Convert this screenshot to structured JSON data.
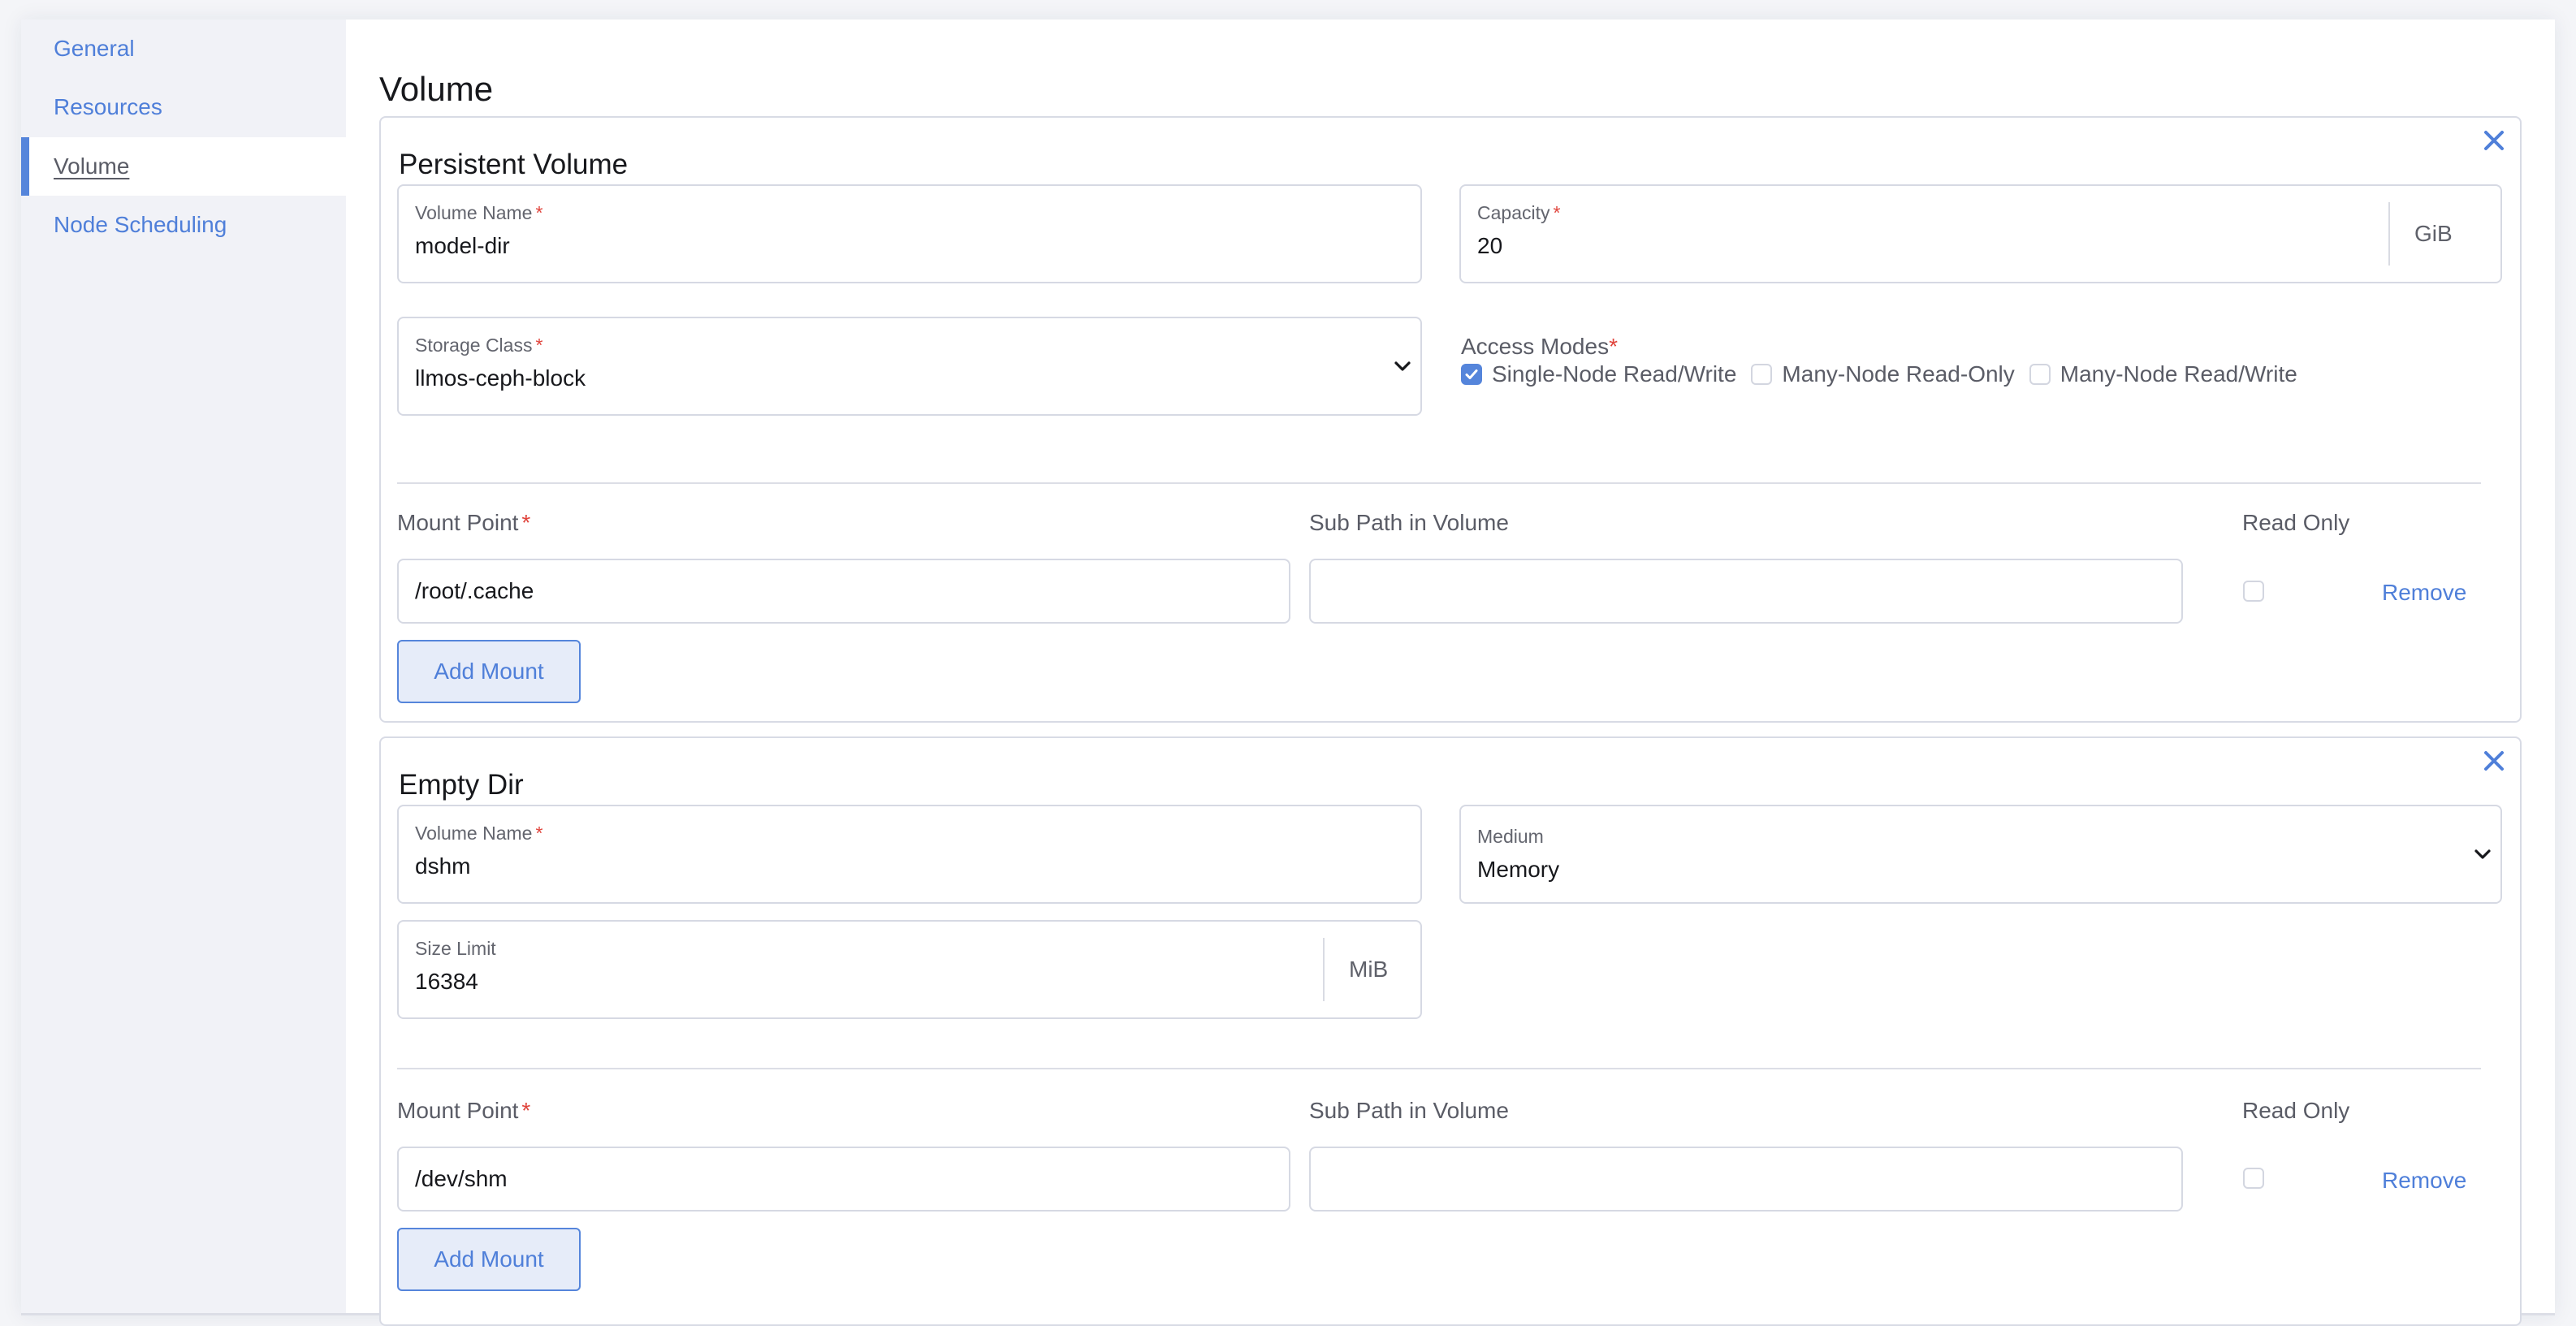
{
  "sidebar": {
    "items": [
      {
        "label": "General",
        "active": false
      },
      {
        "label": "Resources",
        "active": false
      },
      {
        "label": "Volume",
        "active": true
      },
      {
        "label": "Node Scheduling",
        "active": false
      }
    ]
  },
  "page": {
    "title": "Volume"
  },
  "colors": {
    "accent": "#5585db",
    "link": "#4f7fd9",
    "required": "#e0443c",
    "border": "#d6d9e3"
  },
  "persistent_volume": {
    "title": "Persistent Volume",
    "close_icon": "close-icon",
    "volume_name": {
      "label": "Volume Name",
      "required": "*",
      "value": "model-dir"
    },
    "capacity": {
      "label": "Capacity",
      "required": "*",
      "value": "20",
      "unit": "GiB"
    },
    "storage_class": {
      "label": "Storage Class",
      "required": "*",
      "value": "llmos-ceph-block"
    },
    "access_modes": {
      "label": "Access Modes",
      "required": "*",
      "options": [
        {
          "label": "Single-Node Read/Write",
          "checked": true
        },
        {
          "label": "Many-Node Read-Only",
          "checked": false
        },
        {
          "label": "Many-Node Read/Write",
          "checked": false
        }
      ]
    },
    "mount": {
      "mount_point_label": "Mount Point",
      "mount_point_required": "*",
      "mount_point_value": "/root/.cache",
      "sub_path_label": "Sub Path in Volume",
      "sub_path_value": "",
      "read_only_label": "Read Only",
      "read_only": false,
      "remove_label": "Remove"
    },
    "add_mount_label": "Add Mount"
  },
  "empty_dir": {
    "title": "Empty Dir",
    "close_icon": "close-icon",
    "volume_name": {
      "label": "Volume Name",
      "required": "*",
      "value": "dshm"
    },
    "medium": {
      "label": "Medium",
      "value": "Memory"
    },
    "size_limit": {
      "label": "Size Limit",
      "value": "16384",
      "unit": "MiB"
    },
    "mount": {
      "mount_point_label": "Mount Point",
      "mount_point_required": "*",
      "mount_point_value": "/dev/shm",
      "sub_path_label": "Sub Path in Volume",
      "sub_path_value": "",
      "read_only_label": "Read Only",
      "read_only": false,
      "remove_label": "Remove"
    },
    "add_mount_label": "Add Mount"
  }
}
